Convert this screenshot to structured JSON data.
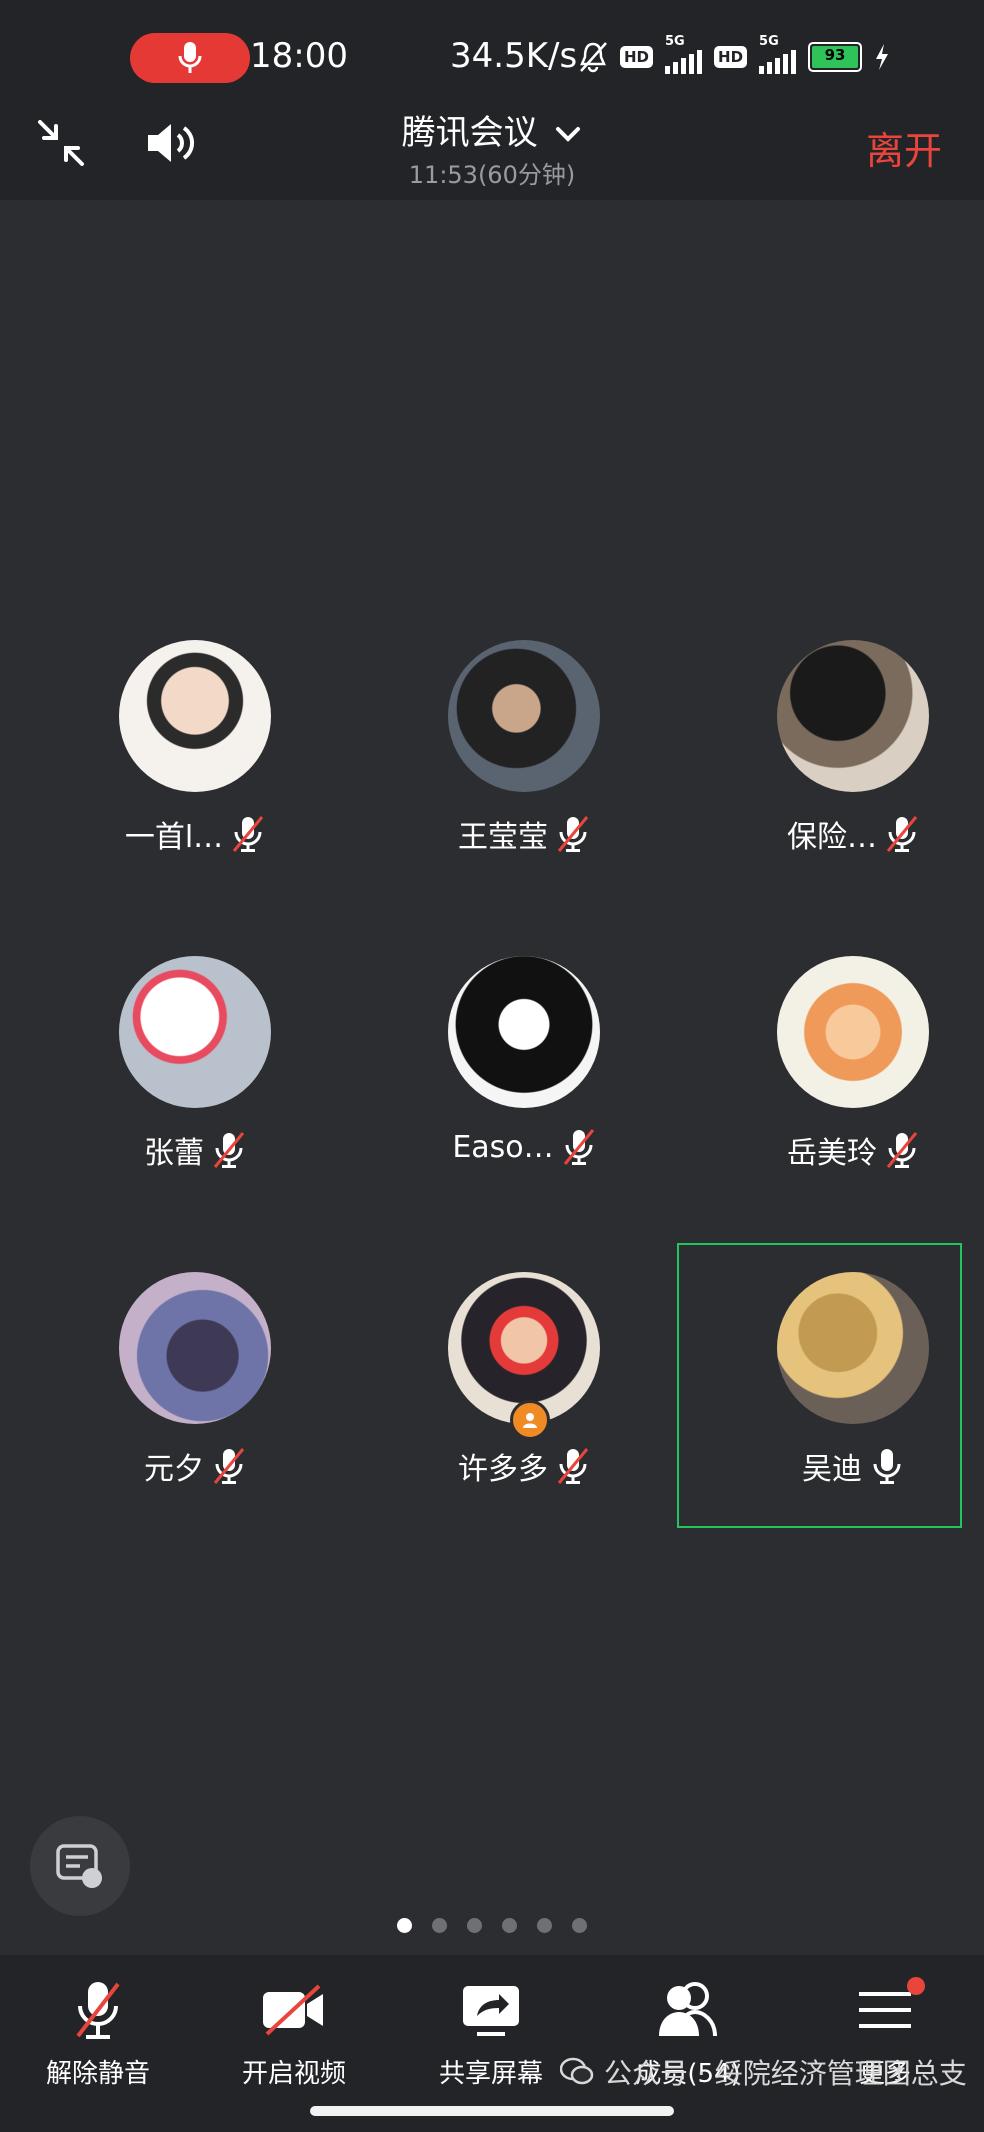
{
  "status_bar": {
    "time": "18:00",
    "net_speed": "34.5K/s",
    "hd1": "HD",
    "net1": "5G",
    "hd2": "HD",
    "net2": "5G",
    "battery": "93",
    "icons": [
      "mic-recording-icon",
      "mute-bell-icon",
      "signal-icon",
      "battery-icon",
      "charging-icon"
    ]
  },
  "header": {
    "title": "腾讯会议",
    "subtitle": "11:53(60分钟)",
    "leave_label": "离开"
  },
  "participants": [
    {
      "name": "一首l…",
      "mic": "muted"
    },
    {
      "name": "王莹莹",
      "mic": "muted"
    },
    {
      "name": "保险…",
      "mic": "muted"
    },
    {
      "name": "张蕾",
      "mic": "muted"
    },
    {
      "name": "Easo…",
      "mic": "muted"
    },
    {
      "name": "岳美玲",
      "mic": "muted"
    },
    {
      "name": "元夕",
      "mic": "muted"
    },
    {
      "name": "许多多",
      "mic": "muted",
      "host": true
    },
    {
      "name": "吴迪",
      "mic": "on",
      "active": true
    }
  ],
  "pager": {
    "pages": 6,
    "current": 1
  },
  "toolbar": {
    "unmute_label": "解除静音",
    "video_label": "开启视频",
    "share_label": "共享屏幕",
    "members_label": "成员(54)",
    "more_label": "更多"
  },
  "watermark": "公众号 · 绥院经济管理团总支",
  "colors": {
    "accent_red": "#e8453c",
    "active_green": "#22c55e",
    "host_orange": "#f08a24",
    "bg": "#2c2d30"
  }
}
